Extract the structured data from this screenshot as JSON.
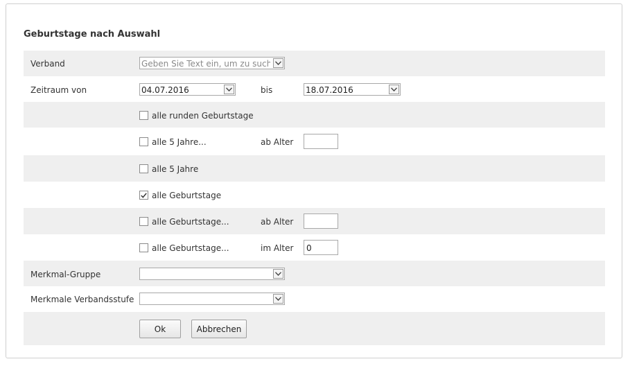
{
  "form": {
    "title": "Geburtstage nach Auswahl",
    "verband": {
      "label": "Verband",
      "placeholder": "Geben Sie Text ein, um zu suchen"
    },
    "zeitraum": {
      "label": "Zeitraum von",
      "from": "04.07.2016",
      "bis_label": "bis",
      "to": "18.07.2016"
    },
    "options": [
      {
        "label": "alle runden Geburtstage",
        "checked": false
      },
      {
        "label": "alle 5 Jahre...",
        "checked": false,
        "side_label": "ab Alter",
        "value": ""
      },
      {
        "label": "alle 5 Jahre",
        "checked": false
      },
      {
        "label": "alle Geburtstage",
        "checked": true
      },
      {
        "label": "alle Geburtstage...",
        "checked": false,
        "side_label": "ab Alter",
        "value": ""
      },
      {
        "label": "alle Geburtstage...",
        "checked": false,
        "side_label": "im Alter",
        "value": "0"
      }
    ],
    "merkmal_gruppe": {
      "label": "Merkmal-Gruppe",
      "value": ""
    },
    "merkmale_verbandsstufe": {
      "label": "Merkmale Verbandsstufe",
      "value": ""
    },
    "buttons": {
      "ok": "Ok",
      "cancel": "Abbrechen"
    }
  },
  "icons": {
    "dropdown": "chevron-down-icon",
    "check": "checkmark-icon"
  },
  "colors": {
    "row_shade": "#efefef",
    "border": "#cfcfcf"
  }
}
